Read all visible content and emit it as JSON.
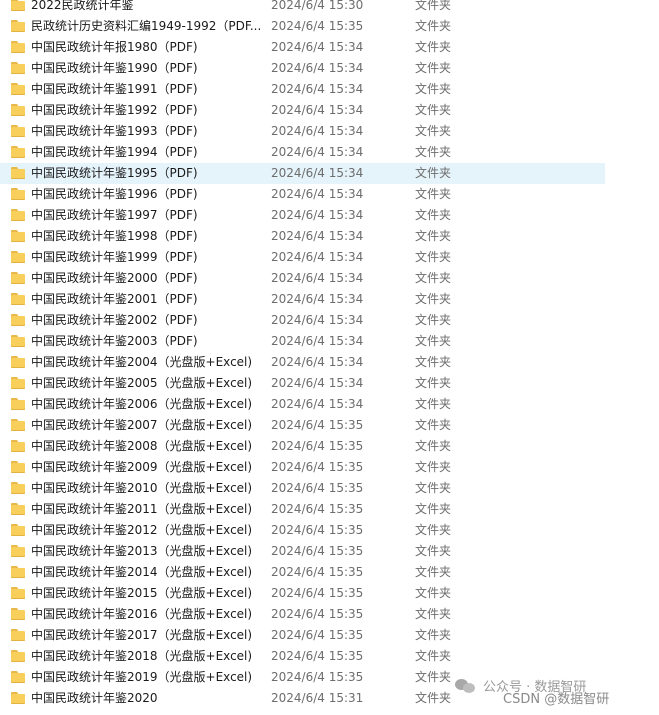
{
  "files": [
    {
      "name": "2022民政统计年鉴",
      "modified": "2024/6/4 15:30",
      "type": "文件夹"
    },
    {
      "name": "民政统计历史资料汇编1949-1992（PDF...",
      "modified": "2024/6/4 15:35",
      "type": "文件夹"
    },
    {
      "name": "中国民政统计年报1980（PDF)",
      "modified": "2024/6/4 15:34",
      "type": "文件夹"
    },
    {
      "name": "中国民政统计年鉴1990（PDF)",
      "modified": "2024/6/4 15:34",
      "type": "文件夹"
    },
    {
      "name": "中国民政统计年鉴1991（PDF)",
      "modified": "2024/6/4 15:34",
      "type": "文件夹"
    },
    {
      "name": "中国民政统计年鉴1992（PDF)",
      "modified": "2024/6/4 15:34",
      "type": "文件夹"
    },
    {
      "name": "中国民政统计年鉴1993（PDF)",
      "modified": "2024/6/4 15:34",
      "type": "文件夹"
    },
    {
      "name": "中国民政统计年鉴1994（PDF)",
      "modified": "2024/6/4 15:34",
      "type": "文件夹"
    },
    {
      "name": "中国民政统计年鉴1995（PDF)",
      "modified": "2024/6/4 15:34",
      "type": "文件夹",
      "selected": true
    },
    {
      "name": "中国民政统计年鉴1996（PDF)",
      "modified": "2024/6/4 15:34",
      "type": "文件夹"
    },
    {
      "name": "中国民政统计年鉴1997（PDF)",
      "modified": "2024/6/4 15:34",
      "type": "文件夹"
    },
    {
      "name": "中国民政统计年鉴1998（PDF)",
      "modified": "2024/6/4 15:34",
      "type": "文件夹"
    },
    {
      "name": "中国民政统计年鉴1999（PDF)",
      "modified": "2024/6/4 15:34",
      "type": "文件夹"
    },
    {
      "name": "中国民政统计年鉴2000（PDF)",
      "modified": "2024/6/4 15:34",
      "type": "文件夹"
    },
    {
      "name": "中国民政统计年鉴2001（PDF)",
      "modified": "2024/6/4 15:34",
      "type": "文件夹"
    },
    {
      "name": "中国民政统计年鉴2002（PDF)",
      "modified": "2024/6/4 15:34",
      "type": "文件夹"
    },
    {
      "name": "中国民政统计年鉴2003（PDF)",
      "modified": "2024/6/4 15:34",
      "type": "文件夹"
    },
    {
      "name": "中国民政统计年鉴2004（光盘版+Excel)",
      "modified": "2024/6/4 15:34",
      "type": "文件夹"
    },
    {
      "name": "中国民政统计年鉴2005（光盘版+Excel)",
      "modified": "2024/6/4 15:34",
      "type": "文件夹"
    },
    {
      "name": "中国民政统计年鉴2006（光盘版+Excel)",
      "modified": "2024/6/4 15:34",
      "type": "文件夹"
    },
    {
      "name": "中国民政统计年鉴2007（光盘版+Excel)",
      "modified": "2024/6/4 15:35",
      "type": "文件夹"
    },
    {
      "name": "中国民政统计年鉴2008（光盘版+Excel)",
      "modified": "2024/6/4 15:35",
      "type": "文件夹"
    },
    {
      "name": "中国民政统计年鉴2009（光盘版+Excel)",
      "modified": "2024/6/4 15:35",
      "type": "文件夹"
    },
    {
      "name": "中国民政统计年鉴2010（光盘版+Excel)",
      "modified": "2024/6/4 15:35",
      "type": "文件夹"
    },
    {
      "name": "中国民政统计年鉴2011（光盘版+Excel)",
      "modified": "2024/6/4 15:35",
      "type": "文件夹"
    },
    {
      "name": "中国民政统计年鉴2012（光盘版+Excel)",
      "modified": "2024/6/4 15:35",
      "type": "文件夹"
    },
    {
      "name": "中国民政统计年鉴2013（光盘版+Excel)",
      "modified": "2024/6/4 15:35",
      "type": "文件夹"
    },
    {
      "name": "中国民政统计年鉴2014（光盘版+Excel)",
      "modified": "2024/6/4 15:35",
      "type": "文件夹"
    },
    {
      "name": "中国民政统计年鉴2015（光盘版+Excel)",
      "modified": "2024/6/4 15:35",
      "type": "文件夹"
    },
    {
      "name": "中国民政统计年鉴2016（光盘版+Excel)",
      "modified": "2024/6/4 15:35",
      "type": "文件夹"
    },
    {
      "name": "中国民政统计年鉴2017（光盘版+Excel)",
      "modified": "2024/6/4 15:35",
      "type": "文件夹"
    },
    {
      "name": "中国民政统计年鉴2018（光盘版+Excel)",
      "modified": "2024/6/4 15:35",
      "type": "文件夹"
    },
    {
      "name": "中国民政统计年鉴2019（光盘版+Excel)",
      "modified": "2024/6/4 15:35",
      "type": "文件夹"
    },
    {
      "name": "中国民政统计年鉴2020",
      "modified": "2024/6/4 15:31",
      "type": "文件夹"
    }
  ],
  "watermark": {
    "line1": "公众号 · 数据智研",
    "line2": "CSDN @数据智研"
  },
  "colors": {
    "selected_row": "#e5f3fb",
    "folder": "#f7cf5a",
    "meta_text": "#6d6d6d"
  },
  "icons": {
    "folder": "folder-icon",
    "wechat": "wechat-icon"
  }
}
